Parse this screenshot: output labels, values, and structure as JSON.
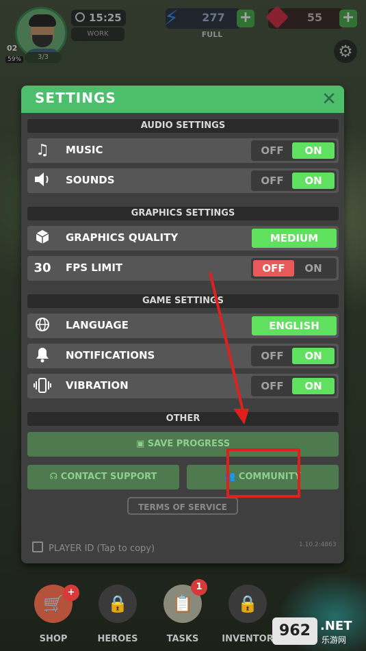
{
  "hud": {
    "level": "02",
    "progress_pct": "59%",
    "heroes_count": "3/3",
    "time": "15:25",
    "status": "WORK",
    "energy": "277",
    "energy_status": "FULL",
    "gems": "55",
    "plus": "+"
  },
  "settings": {
    "title": "SETTINGS",
    "close": "✕",
    "sections": {
      "audio": "AUDIO SETTINGS",
      "graphics": "GRAPHICS SETTINGS",
      "game": "GAME SETTINGS",
      "other": "OTHER"
    },
    "off_label": "OFF",
    "on_label": "ON",
    "music": {
      "label": "MUSIC",
      "icon": "music-note-icon",
      "state": "on"
    },
    "sounds": {
      "label": "SOUNDS",
      "icon": "speaker-icon",
      "state": "on"
    },
    "graphics_quality": {
      "label": "GRAPHICS QUALITY",
      "icon": "cube-icon",
      "value": "MEDIUM"
    },
    "fps_limit": {
      "label": "FPS LIMIT",
      "icon_text": "30",
      "state": "off"
    },
    "language": {
      "label": "LANGUAGE",
      "icon": "globe-icon",
      "value": "ENGLISH"
    },
    "notifications": {
      "label": "NOTIFICATIONS",
      "icon": "bell-icon",
      "state": "on"
    },
    "vibration": {
      "label": "VIBRATION",
      "icon": "vibration-icon",
      "state": "on"
    },
    "save_progress": "SAVE PROGRESS",
    "contact_support": "CONTACT SUPPORT",
    "community": "COMMUNITY",
    "terms": "TERMS OF SERVICE",
    "player_id": "PLAYER ID (Tap to copy)",
    "version": "1.10.2:4863"
  },
  "nav": {
    "shop": "SHOP",
    "heroes": "HEROES",
    "tasks": "TASKS",
    "tasks_badge": "1",
    "inventory": "INVENTOR",
    "shop_badge": "+"
  },
  "watermark": {
    "logo": "962",
    "net": ".NET",
    "sub": "乐游网"
  },
  "colors": {
    "accent_green": "#4cbe6c",
    "toggle_on": "#5fe05f",
    "toggle_off": "#e85a5a",
    "highlight_red": "#e0201c"
  }
}
